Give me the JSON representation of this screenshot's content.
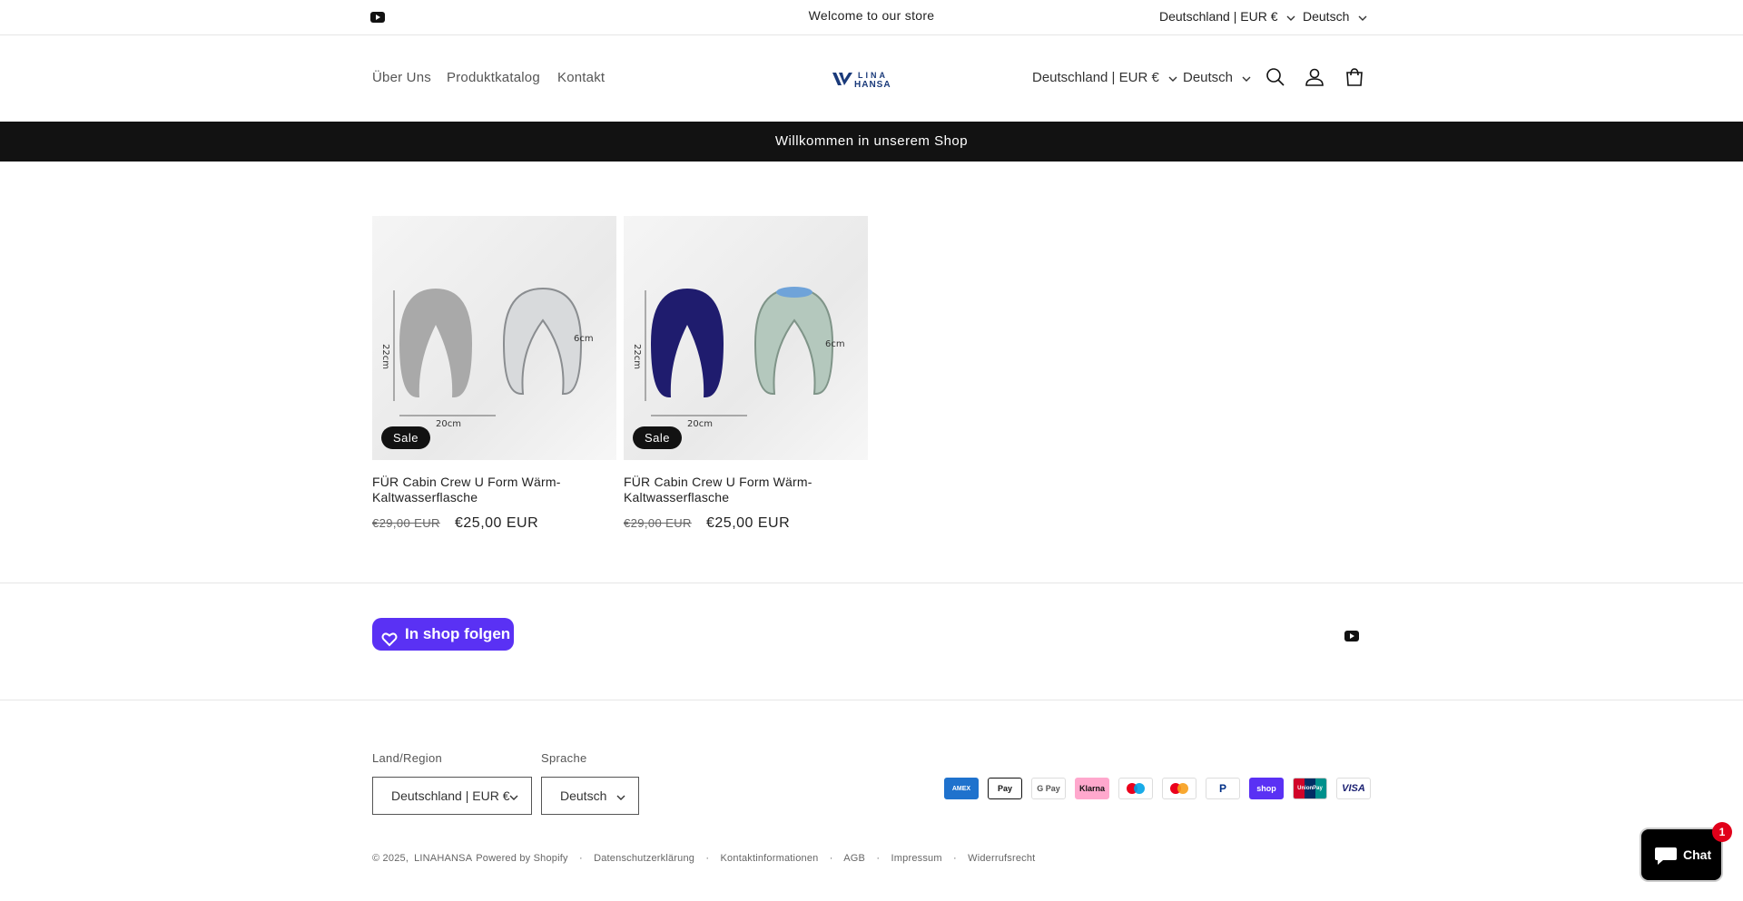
{
  "announcement": {
    "text": "Welcome to our store",
    "country": "Deutschland | EUR €",
    "language": "Deutsch"
  },
  "header": {
    "nav": [
      "Über Uns",
      "Produktkatalog",
      "Kontakt"
    ],
    "logo_line1": "LINA",
    "logo_line2": "HANSA",
    "country": "Deutschland | EUR €",
    "language": "Deutsch"
  },
  "banner": {
    "text": "Willkommen in unserem Shop"
  },
  "products": [
    {
      "badge": "Sale",
      "title": "FÜR Cabin Crew U Form Wärm-Kaltwasserflasche",
      "old_price": "€29,00 EUR",
      "price": "€25,00 EUR",
      "pillow_color": "#a9a9a9",
      "dim_h": "22cm",
      "dim_w": "20cm",
      "dim_d": "6cm"
    },
    {
      "badge": "Sale",
      "title": "FÜR Cabin Crew U Form Wärm-Kaltwasserflasche",
      "old_price": "€29,00 EUR",
      "price": "€25,00 EUR",
      "pillow_color": "#1f1c6e",
      "dim_h": "22cm",
      "dim_w": "20cm",
      "dim_d": "6cm"
    }
  ],
  "follow_button": "In shop folgen",
  "footer": {
    "country_label": "Land/Region",
    "country_value": "Deutschland | EUR €",
    "language_label": "Sprache",
    "language_value": "Deutsch",
    "payments": [
      "American Express",
      "Apple Pay",
      "Google Pay",
      "Klarna",
      "Maestro",
      "Mastercard",
      "PayPal",
      "Shop Pay",
      "UnionPay",
      "Visa"
    ],
    "copyright": "© 2025,",
    "brand": "LINAHANSA",
    "powered": "Powered by Shopify",
    "links": [
      "Datenschutzerklärung",
      "Kontaktinformationen",
      "AGB",
      "Impressum",
      "Widerrufsrecht"
    ]
  },
  "chat": {
    "label": "Chat",
    "count": "1"
  },
  "colors": {
    "follow": "#5a31f4",
    "banner": "#121212",
    "logo": "#1a3a7a",
    "chat_badge": "#e1001a"
  }
}
